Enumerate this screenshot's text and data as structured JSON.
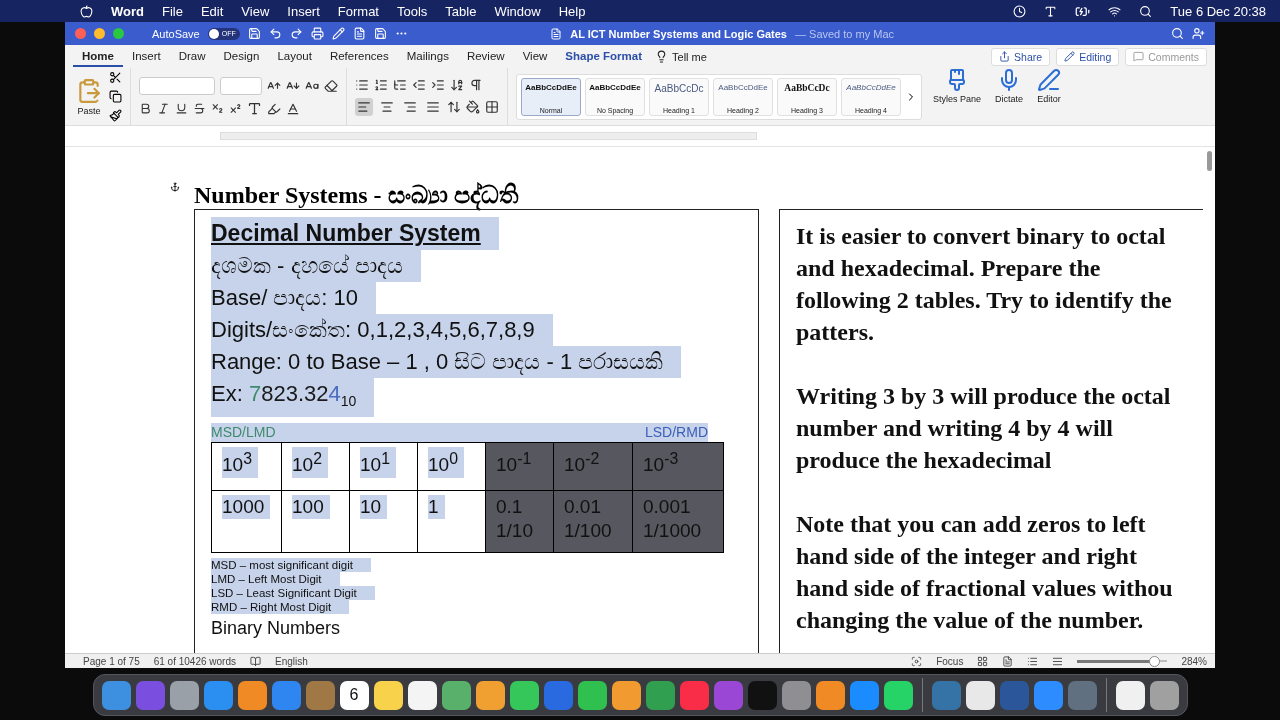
{
  "menu_bar": {
    "app": "Word",
    "items": [
      "File",
      "Edit",
      "View",
      "Insert",
      "Format",
      "Tools",
      "Table",
      "Window",
      "Help"
    ],
    "clock": "Tue 6 Dec  20:38"
  },
  "title_bar": {
    "autosave_label": "AutoSave",
    "autosave_on": false,
    "autosave_state": "OFF",
    "title": "AL ICT Number Systems and Logic Gates",
    "subtitle": "— Saved to my Mac"
  },
  "ribbon_tabs": [
    {
      "label": "Home",
      "selected": true,
      "kind": "normal"
    },
    {
      "label": "Insert",
      "selected": false,
      "kind": "normal"
    },
    {
      "label": "Draw",
      "selected": false,
      "kind": "normal"
    },
    {
      "label": "Design",
      "selected": false,
      "kind": "normal"
    },
    {
      "label": "Layout",
      "selected": false,
      "kind": "normal"
    },
    {
      "label": "References",
      "selected": false,
      "kind": "normal"
    },
    {
      "label": "Mailings",
      "selected": false,
      "kind": "normal"
    },
    {
      "label": "Review",
      "selected": false,
      "kind": "normal"
    },
    {
      "label": "View",
      "selected": false,
      "kind": "normal"
    },
    {
      "label": "Shape Format",
      "selected": false,
      "kind": "contextual"
    }
  ],
  "tell_me": "Tell me",
  "actions": [
    {
      "label": "Share",
      "disabled": false,
      "kind": "share"
    },
    {
      "label": "Editing",
      "disabled": false,
      "kind": "editing"
    },
    {
      "label": "Comments",
      "disabled": true,
      "kind": "comments"
    }
  ],
  "paste_label": "Paste",
  "align_buttons": [
    {
      "selected": true
    },
    {
      "selected": false
    },
    {
      "selected": false
    },
    {
      "selected": false
    }
  ],
  "styles": [
    {
      "sample": "AaBbCcDdEe",
      "name": "Normal",
      "kind": "body",
      "selected": true
    },
    {
      "sample": "AaBbCcDdEe",
      "name": "No Spacing",
      "kind": "body",
      "selected": false
    },
    {
      "sample": "AaBbCcDc",
      "name": "Heading 1",
      "kind": "heading1",
      "selected": false
    },
    {
      "sample": "AaBbCcDdEe",
      "name": "Heading 2",
      "kind": "heading2",
      "selected": false
    },
    {
      "sample": "AaBbCcDc",
      "name": "Heading 3",
      "kind": "heading3",
      "selected": false
    },
    {
      "sample": "AaBbCcDdEe",
      "name": "Heading 4",
      "kind": "heading4",
      "selected": false
    }
  ],
  "tools": [
    {
      "label": "Styles Pane",
      "kind": "styles"
    },
    {
      "label": "Dictate",
      "kind": "dictate"
    },
    {
      "label": "Editor",
      "kind": "editor"
    }
  ],
  "document": {
    "heading": "Number Systems - සංඛ්‍යා පද්ධති",
    "left_box": {
      "title": {
        "text": "Decimal Number System",
        "selected": true
      },
      "lines": [
        {
          "text": "දශමක - දහයේ පාදය",
          "selected": true
        },
        {
          "text": "Base/ පාදය: 10",
          "selected": true
        },
        {
          "text": "Digits/සංකේත: 0,1,2,3,4,5,6,7,8,9",
          "selected": true
        },
        {
          "text": "Range: 0 to Base – 1 , 0 සිට පාදය - 1 පරාසයකි",
          "selected": true
        }
      ],
      "example": {
        "label": "Ex:",
        "parts": [
          {
            "text": "7",
            "color": "#3f8a6e"
          },
          {
            "text": "823.32",
            "color": "#1a1a1a"
          },
          {
            "text": "4",
            "color": "#4a6cc0"
          }
        ],
        "base": "10",
        "selected": true
      },
      "scale_labels": {
        "left": "MSD/LMD",
        "right": "LSD/RMD",
        "selected": true
      },
      "table": [
        {
          "power": "10$^{3}$",
          "value": "1000",
          "shaded": false
        },
        {
          "power": "10$^{2}$",
          "value": "100",
          "shaded": false
        },
        {
          "power": "10$^{1}$",
          "value": "10",
          "shaded": false
        },
        {
          "power": "10$^{0}$",
          "value": "1",
          "shaded": false
        },
        {
          "power": "10$^{-1}$",
          "value": "0.1",
          "fraction": "1/10",
          "shaded": true
        },
        {
          "power": "10$^{-2}$",
          "value": "0.01",
          "fraction": "1/100",
          "shaded": true
        },
        {
          "power": "10$^{-3}$",
          "value": "0.001",
          "fraction": "1/1000",
          "shaded": true
        }
      ],
      "notes": [
        {
          "text": "MSD – most significant digit",
          "selected": true
        },
        {
          "text": "LMD – Left Most Digit",
          "selected": true
        },
        {
          "text": "LSD – Least Significant Digit",
          "selected": true
        },
        {
          "text": "RMD – Right Most Digit",
          "selected": true
        }
      ],
      "next_heading": "Binary Numbers"
    },
    "right_box": {
      "paragraphs": [
        [
          "It is easier to convert binary to octal",
          "and hexadecimal. Prepare the",
          "following 2 tables. Try to identify the",
          "patters."
        ],
        [
          "Writing 3 by 3 will produce the octal",
          "number and writing 4 by 4 will",
          "produce the hexadecimal"
        ],
        [
          "Note that you can add zeros to left",
          "hand side of the integer and right",
          "hand side of fractional values withou",
          "changing the value of the number."
        ]
      ]
    }
  },
  "status_bar": {
    "page": "Page 1 of 75",
    "words": "61 of 10426 words",
    "language": "English",
    "focus": "Focus",
    "zoom": "284%",
    "zoom_slider": {
      "level": 0.85
    }
  },
  "dock": {
    "groups": [
      [
        {
          "color": "#3d8fe0"
        },
        {
          "color": "#7a4fe0"
        },
        {
          "color": "#9aa0a8"
        },
        {
          "color": "#2a8ff0"
        },
        {
          "color": "#f08a24"
        },
        {
          "color": "#2f86f0"
        },
        {
          "color": "#a07845"
        },
        {
          "color": "#ffffff",
          "label": "6"
        },
        {
          "color": "#f7d24a"
        },
        {
          "color": "#f4f4f4"
        },
        {
          "color": "#58b06a"
        },
        {
          "color": "#f0a030"
        },
        {
          "color": "#35c759"
        },
        {
          "color": "#2a6ae0"
        },
        {
          "color": "#30c050"
        },
        {
          "color": "#f09a30"
        },
        {
          "color": "#30a050"
        },
        {
          "color": "#fa2d48"
        },
        {
          "color": "#9b47d6"
        },
        {
          "color": "#111111"
        },
        {
          "color": "#8e8e93"
        },
        {
          "color": "#f08a24"
        },
        {
          "color": "#1a8cff"
        },
        {
          "color": "#25d366"
        }
      ],
      [
        {
          "color": "#3572a5"
        },
        {
          "color": "#e8e8e8"
        },
        {
          "color": "#2b579a"
        },
        {
          "color": "#2d8cff"
        },
        {
          "color": "#607080"
        }
      ],
      [
        {
          "color": "#f0f0f0"
        },
        {
          "color": "#a0a0a0"
        }
      ]
    ]
  }
}
